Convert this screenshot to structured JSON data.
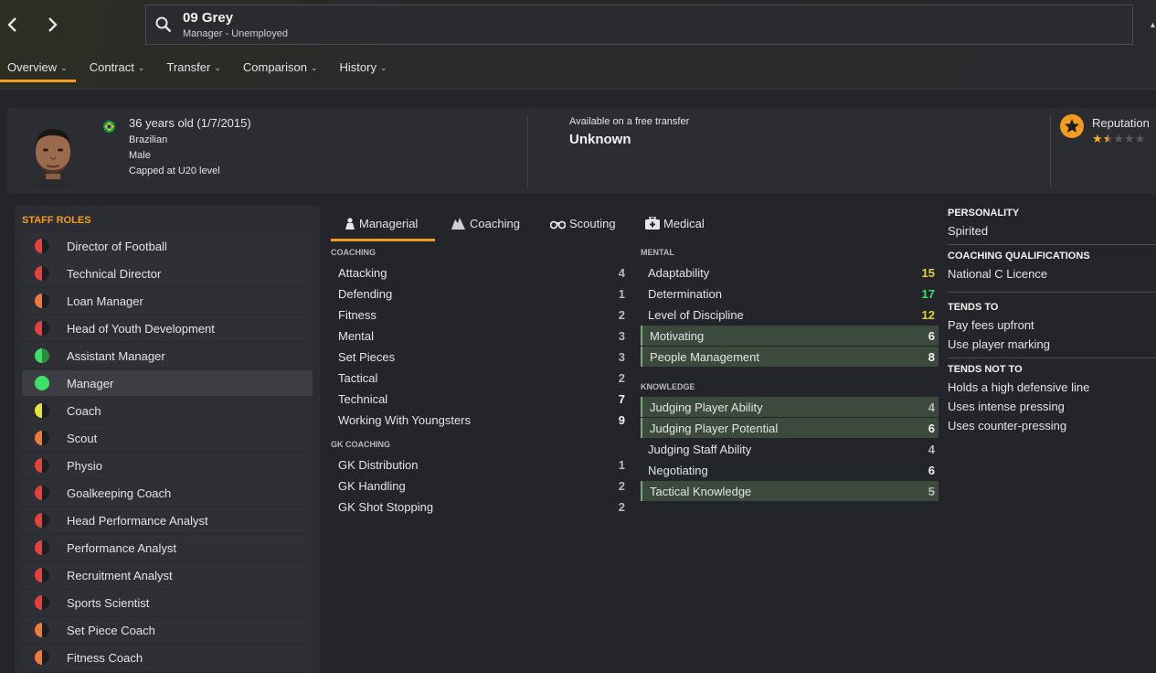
{
  "header": {
    "name": "09 Grey",
    "subtitle": "Manager - Unemployed",
    "tabs": [
      {
        "label": "Overview"
      },
      {
        "label": "Contract"
      },
      {
        "label": "Transfer"
      },
      {
        "label": "Comparison"
      },
      {
        "label": "History"
      }
    ],
    "active_tab": "Overview"
  },
  "info": {
    "age": "36 years old (1/7/2015)",
    "nationality": "Brazilian",
    "gender": "Male",
    "caps": "Capped at U20 level",
    "transfer_label": "Available on a free transfer",
    "transfer_value": "Unknown",
    "reputation_label": "Reputation",
    "reputation_stars": 1.5,
    "reputation_max": 5
  },
  "staff_roles": {
    "title": "STAFF ROLES",
    "selected": "Manager",
    "items": [
      {
        "label": "Director of Football",
        "suitability": "red"
      },
      {
        "label": "Technical Director",
        "suitability": "red"
      },
      {
        "label": "Loan Manager",
        "suitability": "orange"
      },
      {
        "label": "Head of Youth Development",
        "suitability": "red"
      },
      {
        "label": "Assistant Manager",
        "suitability": "green-half"
      },
      {
        "label": "Manager",
        "suitability": "green"
      },
      {
        "label": "Coach",
        "suitability": "yellow"
      },
      {
        "label": "Scout",
        "suitability": "orange"
      },
      {
        "label": "Physio",
        "suitability": "red"
      },
      {
        "label": "Goalkeeping Coach",
        "suitability": "red"
      },
      {
        "label": "Head Performance Analyst",
        "suitability": "red"
      },
      {
        "label": "Performance Analyst",
        "suitability": "red"
      },
      {
        "label": "Recruitment Analyst",
        "suitability": "red"
      },
      {
        "label": "Sports Scientist",
        "suitability": "red"
      },
      {
        "label": "Set Piece Coach",
        "suitability": "orange"
      },
      {
        "label": "Fitness Coach",
        "suitability": "orange"
      }
    ]
  },
  "attribute_tabs": [
    {
      "label": "Managerial",
      "icon": "person-icon"
    },
    {
      "label": "Coaching",
      "icon": "coaching-icon"
    },
    {
      "label": "Scouting",
      "icon": "binoculars-icon"
    },
    {
      "label": "Medical",
      "icon": "medical-kit-icon"
    }
  ],
  "active_attribute_tab": "Managerial",
  "coaching": {
    "title": "COACHING",
    "items": [
      {
        "label": "Attacking",
        "value": "4"
      },
      {
        "label": "Defending",
        "value": "1"
      },
      {
        "label": "Fitness",
        "value": "2"
      },
      {
        "label": "Mental",
        "value": "3"
      },
      {
        "label": "Set Pieces",
        "value": "3"
      },
      {
        "label": "Tactical",
        "value": "2"
      },
      {
        "label": "Technical",
        "value": "7"
      },
      {
        "label": "Working With Youngsters",
        "value": "9"
      }
    ]
  },
  "gk_coaching": {
    "title": "GK COACHING",
    "items": [
      {
        "label": "GK Distribution",
        "value": "1"
      },
      {
        "label": "GK Handling",
        "value": "2"
      },
      {
        "label": "GK Shot Stopping",
        "value": "2"
      }
    ]
  },
  "mental": {
    "title": "MENTAL",
    "items": [
      {
        "label": "Adaptability",
        "value": "15",
        "color": "#e8d23a"
      },
      {
        "label": "Determination",
        "value": "17",
        "color": "#3ee06a"
      },
      {
        "label": "Level of Discipline",
        "value": "12",
        "color": "#e8d23a"
      },
      {
        "label": "Motivating",
        "value": "6",
        "highlight": true
      },
      {
        "label": "People Management",
        "value": "8",
        "highlight": true
      }
    ]
  },
  "knowledge": {
    "title": "KNOWLEDGE",
    "items": [
      {
        "label": "Judging Player Ability",
        "value": "4",
        "highlight": true
      },
      {
        "label": "Judging Player Potential",
        "value": "6",
        "highlight": true
      },
      {
        "label": "Judging Staff Ability",
        "value": "4"
      },
      {
        "label": "Negotiating",
        "value": "6"
      },
      {
        "label": "Tactical Knowledge",
        "value": "5",
        "highlight": true
      }
    ]
  },
  "side": {
    "personality_title": "PERSONALITY",
    "personality": "Spirited",
    "qualifications_title": "COACHING QUALIFICATIONS",
    "qualification": "National C Licence",
    "tends_to_title": "TENDS TO",
    "tends_to": [
      "Pay fees upfront",
      "Use player marking"
    ],
    "tends_not_to_title": "TENDS NOT TO",
    "tends_not_to": [
      "Holds a high defensive line",
      "Uses intense pressing",
      "Uses counter-pressing"
    ]
  },
  "colors": {
    "accent": "#f39c1f",
    "highlight_row": "#3c4a3d",
    "good": "#3ee06a",
    "mid": "#e8d23a"
  }
}
